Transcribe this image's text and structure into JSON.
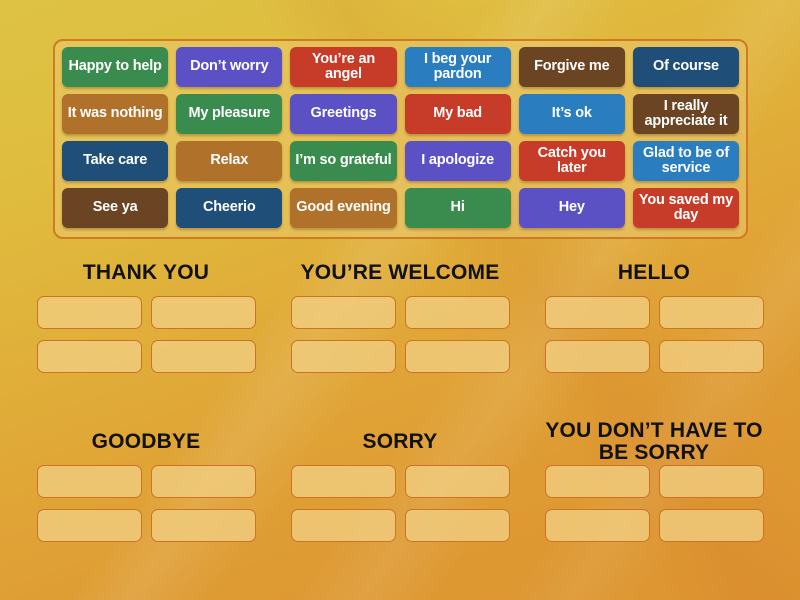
{
  "activity": {
    "type": "group-sort",
    "background_top_color": "#ddc244",
    "background_bottom_color": "#dd9430",
    "tray_border_color": "#d07a22",
    "slot_border_color": "#cd7324"
  },
  "tray": {
    "rows": [
      [
        {
          "label": "Happy to help",
          "color": "#3a8c4e"
        },
        {
          "label": "Don’t worry",
          "color": "#5b51c4"
        },
        {
          "label": "You’re an angel",
          "color": "#c63c28"
        },
        {
          "label": "I beg your pardon",
          "color": "#2a7dbe"
        },
        {
          "label": "Forgive me",
          "color": "#6b4423"
        },
        {
          "label": "Of course",
          "color": "#1f4e79"
        }
      ],
      [
        {
          "label": "It was nothing",
          "color": "#b0712a"
        },
        {
          "label": "My pleasure",
          "color": "#3a8c4e"
        },
        {
          "label": "Greetings",
          "color": "#5b51c4"
        },
        {
          "label": "My bad",
          "color": "#c63c28"
        },
        {
          "label": "It’s ok",
          "color": "#2a7dbe"
        },
        {
          "label": "I really appreciate it",
          "color": "#6b4423"
        }
      ],
      [
        {
          "label": "Take care",
          "color": "#1f4e79"
        },
        {
          "label": "Relax",
          "color": "#b0712a"
        },
        {
          "label": "I’m so grateful",
          "color": "#3a8c4e"
        },
        {
          "label": "I apologize",
          "color": "#5b51c4"
        },
        {
          "label": "Catch you later",
          "color": "#c63c28"
        },
        {
          "label": "Glad to be of service",
          "color": "#2a7dbe"
        }
      ],
      [
        {
          "label": "See ya",
          "color": "#6b4423"
        },
        {
          "label": "Cheerio",
          "color": "#1f4e79"
        },
        {
          "label": "Good evening",
          "color": "#b0712a"
        },
        {
          "label": "Hi",
          "color": "#3a8c4e"
        },
        {
          "label": "Hey",
          "color": "#5b51c4"
        },
        {
          "label": "You saved my day",
          "color": "#c63c28"
        }
      ]
    ]
  },
  "groups": [
    {
      "title": "THANK YOU",
      "slot_count": 4
    },
    {
      "title": "YOU’RE WELCOME",
      "slot_count": 4
    },
    {
      "title": "HELLO",
      "slot_count": 4
    },
    {
      "title": "GOODBYE",
      "slot_count": 4
    },
    {
      "title": "SORRY",
      "slot_count": 4
    },
    {
      "title": "YOU DON’T HAVE TO BE SORRY",
      "slot_count": 4
    }
  ]
}
